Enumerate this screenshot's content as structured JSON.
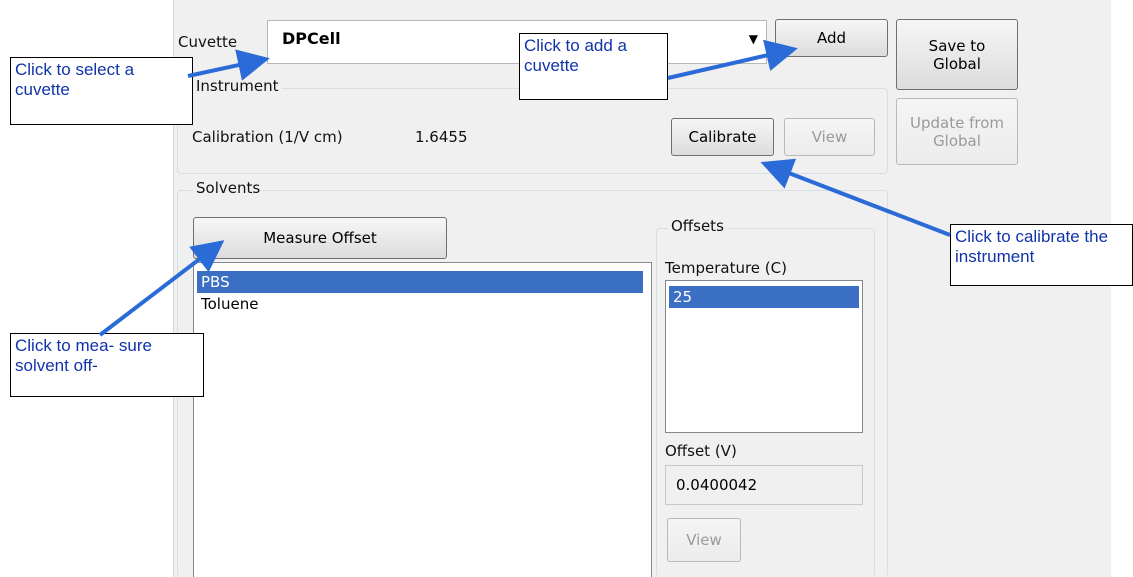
{
  "cuvette": {
    "label": "Cuvette",
    "selected": "DPCell"
  },
  "buttons": {
    "add": "Add",
    "save_to_global": "Save to Global",
    "update_from_global": "Update from Global",
    "calibrate": "Calibrate",
    "view_instrument": "View",
    "measure_offset": "Measure Offset",
    "view_offset": "View"
  },
  "instrument": {
    "title": "Instrument",
    "calibration_label": "Calibration (1/V cm)",
    "calibration_value": "1.6455"
  },
  "solvents": {
    "title": "Solvents",
    "items": [
      "PBS",
      "Toluene"
    ],
    "selected_index": 0
  },
  "offsets": {
    "title": "Offsets",
    "temperature_label": "Temperature (C)",
    "temperatures": [
      "25"
    ],
    "offset_label": "Offset (V)",
    "offset_value": "0.0400042"
  },
  "callouts": {
    "select_cuvette": "Click to select a cuvette",
    "add_cuvette": "Click to add a cuvette",
    "calibrate": "Click to calibrate the instrument",
    "measure_offset": "Click to mea- sure solvent off-"
  },
  "colors": {
    "selection": "#3a6fc4",
    "callout_text": "#1133aa",
    "arrow": "#2a6bd8"
  }
}
